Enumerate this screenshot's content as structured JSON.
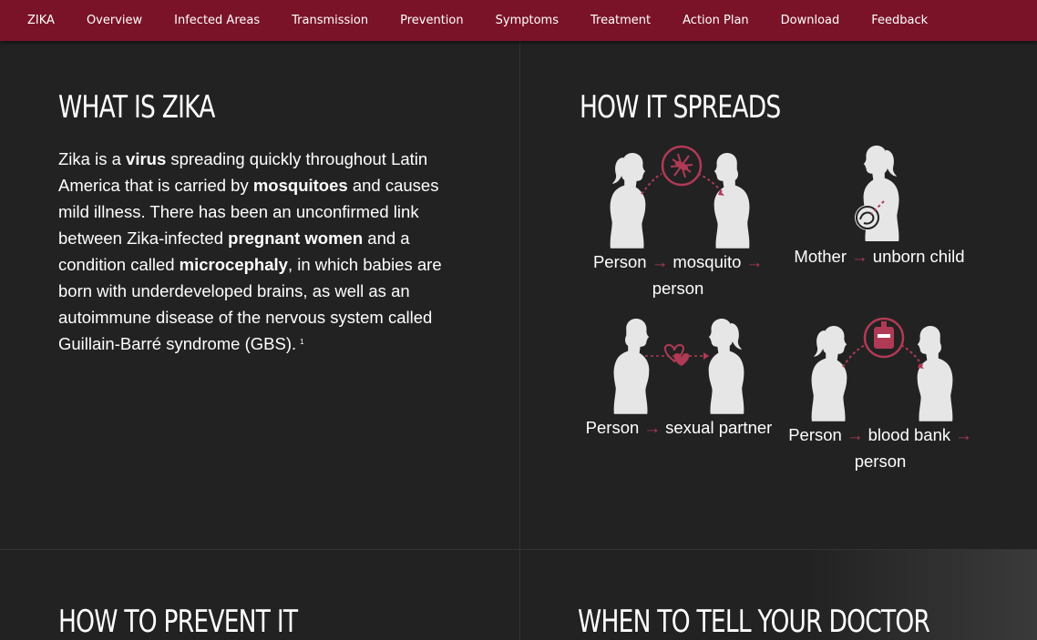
{
  "nav": {
    "items": [
      "ZIKA",
      "Overview",
      "Infected Areas",
      "Transmission",
      "Prevention",
      "Symptoms",
      "Treatment",
      "Action Plan",
      "Download",
      "Feedback"
    ]
  },
  "what_is": {
    "title": "WHAT IS ZIKA",
    "p1": "Zika is a ",
    "b1": "virus",
    "p2": " spreading quickly throughout Latin America that is carried by ",
    "b2": "mosquitoes",
    "p3": " and causes mild illness. There has been an unconfirmed link between Zika-infected ",
    "b3": "pregnant women",
    "p4": " and a condition called ",
    "b4": "microcephaly",
    "p5": ", in which babies are born with underdeveloped brains, as well as an autoimmune disease of the nervous system called Guillain-Barré syndrome (GBS).",
    "footnote": "1"
  },
  "spreads": {
    "title": "HOW IT SPREADS",
    "arrow": "→",
    "mosquito": {
      "a": "Person",
      "b": "mosquito",
      "c": "person"
    },
    "mother": {
      "a": "Mother",
      "b": "unborn child"
    },
    "sexual": {
      "a": "Person",
      "b": "sexual partner"
    },
    "blood": {
      "a": "Person",
      "b": "blood bank",
      "c": "person"
    }
  },
  "prevent": {
    "title": "HOW TO PREVENT IT"
  },
  "doctor": {
    "title": "WHEN TO TELL YOUR DOCTOR"
  },
  "colors": {
    "nav_bg": "#7a1328",
    "accent": "#b03a55",
    "page_bg": "#222222",
    "figure": "#e6e6e6"
  }
}
